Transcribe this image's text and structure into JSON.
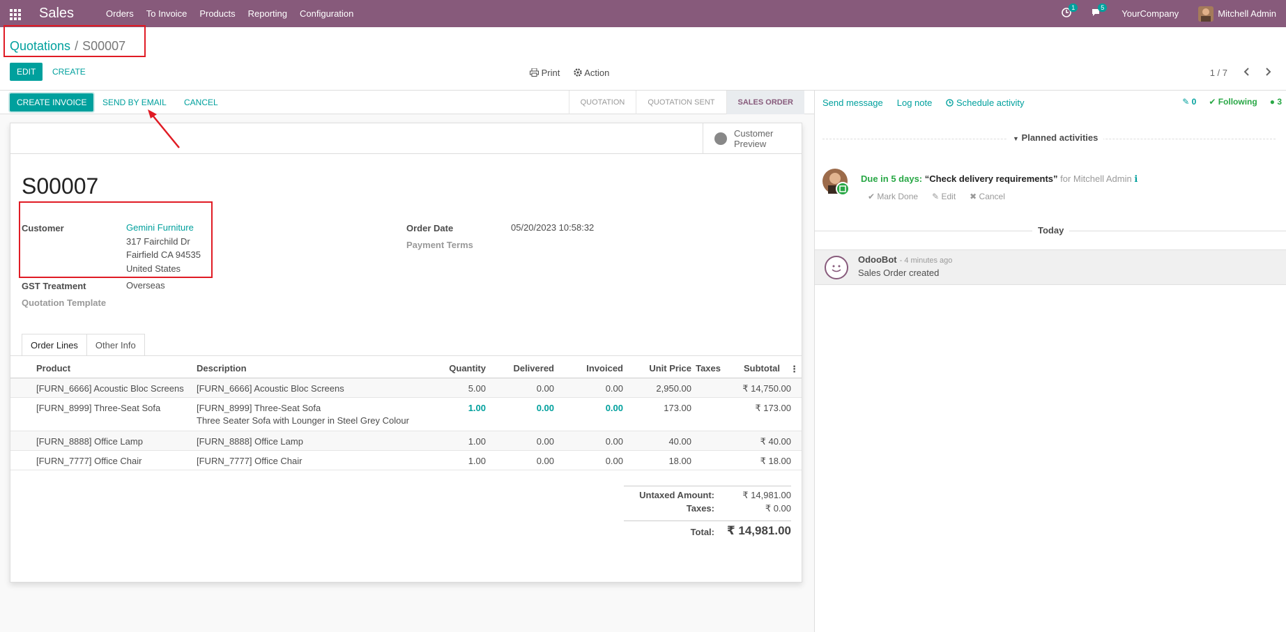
{
  "navbar": {
    "brand": "Sales",
    "menu": [
      "Orders",
      "To Invoice",
      "Products",
      "Reporting",
      "Configuration"
    ],
    "activity_count": "1",
    "message_count": "5",
    "company": "YourCompany",
    "user": "Mitchell Admin"
  },
  "control_panel": {
    "breadcrumb_parent": "Quotations",
    "breadcrumb_sep": "/",
    "breadcrumb_current": "S00007",
    "edit_label": "EDIT",
    "create_label": "CREATE",
    "print_label": "Print",
    "action_label": "Action",
    "pager": "1 / 7"
  },
  "statusbar": {
    "buttons": {
      "create_invoice": "CREATE INVOICE",
      "send_email": "SEND BY EMAIL",
      "cancel": "CANCEL"
    },
    "steps": [
      "QUOTATION",
      "QUOTATION SENT",
      "SALES ORDER"
    ],
    "active_step": "SALES ORDER"
  },
  "form": {
    "smart_button": {
      "line1": "Customer",
      "line2": "Preview"
    },
    "name": "S00007",
    "customer_label": "Customer",
    "customer_name": "Gemini Furniture",
    "customer_addr1": "317 Fairchild Dr",
    "customer_addr2": "Fairfield CA 94535",
    "customer_addr3": "United States",
    "gst_label": "GST Treatment",
    "gst_value": "Overseas",
    "template_label": "Quotation Template",
    "order_date_label": "Order Date",
    "order_date_value": "05/20/2023 10:58:32",
    "payment_terms_label": "Payment Terms",
    "tabs": [
      "Order Lines",
      "Other Info"
    ]
  },
  "order_lines": {
    "headers": {
      "product": "Product",
      "description": "Description",
      "quantity": "Quantity",
      "delivered": "Delivered",
      "invoiced": "Invoiced",
      "unit_price": "Unit Price",
      "taxes": "Taxes",
      "subtotal": "Subtotal"
    },
    "rows": [
      {
        "product": "[FURN_6666] Acoustic Bloc Screens",
        "description": "[FURN_6666] Acoustic Bloc Screens",
        "description2": "",
        "quantity": "5.00",
        "delivered": "0.00",
        "invoiced": "0.00",
        "unit_price": "2,950.00",
        "subtotal": "₹ 14,750.00"
      },
      {
        "product": "[FURN_8999] Three-Seat Sofa",
        "description": "[FURN_8999] Three-Seat Sofa",
        "description2": "Three Seater Sofa with Lounger in Steel Grey Colour",
        "quantity": "1.00",
        "delivered": "0.00",
        "invoiced": "0.00",
        "unit_price": "173.00",
        "subtotal": "₹ 173.00"
      },
      {
        "product": "[FURN_8888] Office Lamp",
        "description": "[FURN_8888] Office Lamp",
        "description2": "",
        "quantity": "1.00",
        "delivered": "0.00",
        "invoiced": "0.00",
        "unit_price": "40.00",
        "subtotal": "₹ 40.00"
      },
      {
        "product": "[FURN_7777] Office Chair",
        "description": "[FURN_7777] Office Chair",
        "description2": "",
        "quantity": "1.00",
        "delivered": "0.00",
        "invoiced": "0.00",
        "unit_price": "18.00",
        "subtotal": "₹ 18.00"
      }
    ]
  },
  "totals": {
    "untaxed_label": "Untaxed Amount:",
    "untaxed_value": "₹ 14,981.00",
    "taxes_label": "Taxes:",
    "taxes_value": "₹ 0.00",
    "total_label": "Total:",
    "total_value": "₹ 14,981.00"
  },
  "chatter": {
    "send_message": "Send message",
    "log_note": "Log note",
    "schedule_activity": "Schedule activity",
    "attachments": "0",
    "following": "Following",
    "followers": "3",
    "planned_label": "Planned activities",
    "activity": {
      "due": "Due in 5 days:",
      "summary": "“Check delivery requirements”",
      "for": "for Mitchell Admin",
      "mark_done": "Mark Done",
      "edit": "Edit",
      "cancel": "Cancel"
    },
    "today_label": "Today",
    "message": {
      "author": "OdooBot",
      "time": "- 4 minutes ago",
      "body": "Sales Order created"
    }
  },
  "colors": {
    "brand": "#875a7b",
    "accent": "#00a09d",
    "highlight": "#e01b24"
  }
}
